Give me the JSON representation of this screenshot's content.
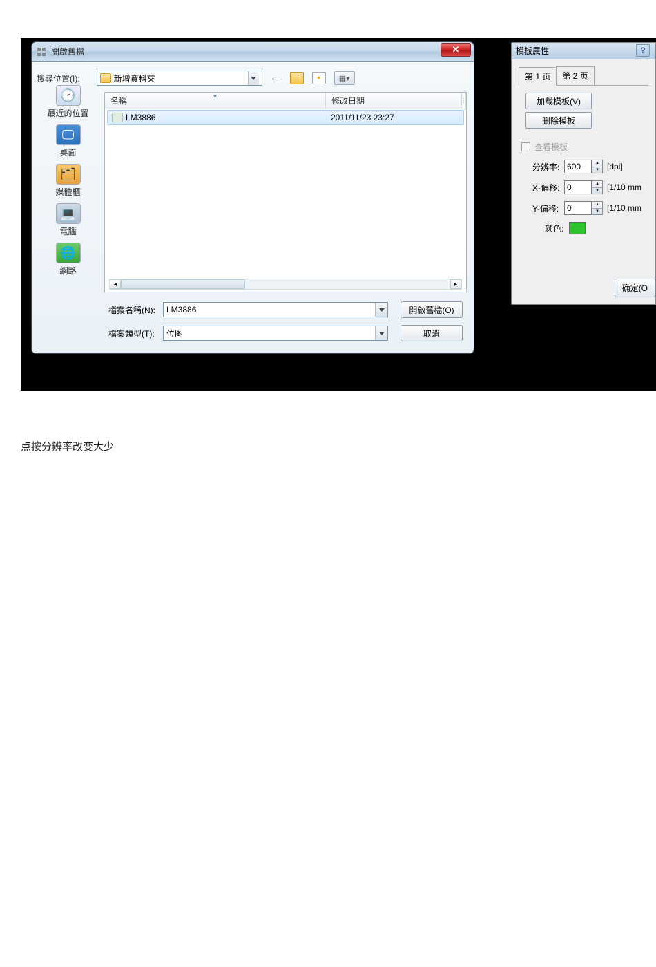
{
  "open_dialog": {
    "title": "開啟舊檔",
    "close": "✕",
    "lookin_label": "搜尋位置(I):",
    "lookin_value": "新增資料夾",
    "sidebar": [
      {
        "label": "最近的位置"
      },
      {
        "label": "桌面"
      },
      {
        "label": "媒體櫃"
      },
      {
        "label": "電腦"
      },
      {
        "label": "網路"
      }
    ],
    "columns": {
      "name": "名稱",
      "mdate": "修改日期"
    },
    "rows": [
      {
        "name": "LM3886",
        "mdate": "2011/11/23 23:27"
      }
    ],
    "filename_label": "檔案名稱(N):",
    "filename_value": "LM3886",
    "filetype_label": "檔案類型(T):",
    "filetype_value": "位图",
    "open_btn": "開啟舊檔(O)",
    "cancel_btn": "取消"
  },
  "tpl_panel": {
    "title": "模板属性",
    "help": "?",
    "tabs": {
      "p1": "第 1 页",
      "p2": "第 2 页"
    },
    "load_btn": "加载模板(V)",
    "delete_btn": "删除模板",
    "view_chk": "查看模板",
    "res_label": "分辨率:",
    "res_value": "600",
    "res_unit": "[dpi]",
    "xoff_label": "X-偏移:",
    "xoff_value": "0",
    "xoff_unit": "[1/10 mm",
    "yoff_label": "Y-偏移:",
    "yoff_value": "0",
    "yoff_unit": "[1/10 mm",
    "color_label": "颜色:",
    "ok_btn": "确定(O"
  },
  "caption": "点按分辨率改变大少"
}
